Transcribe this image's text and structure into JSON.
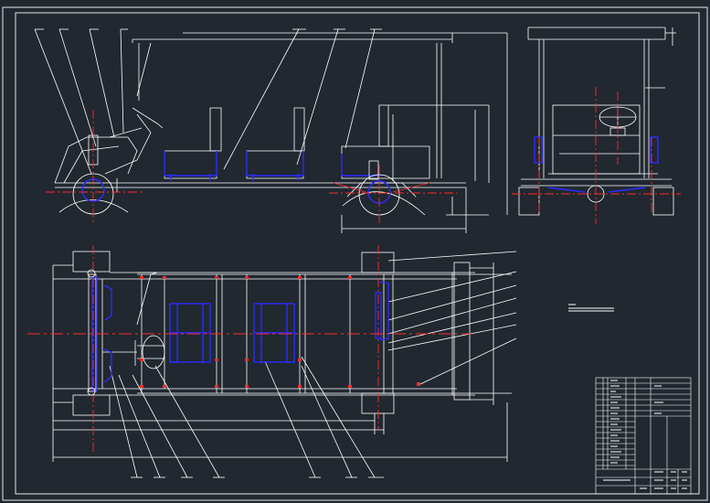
{
  "drawing": {
    "background": "#212830",
    "line_color": "#ffffff",
    "part_color": "#2b2bff",
    "center_color": "#ff2a2a",
    "title_block": {
      "rows": 18,
      "columns": 5
    }
  }
}
